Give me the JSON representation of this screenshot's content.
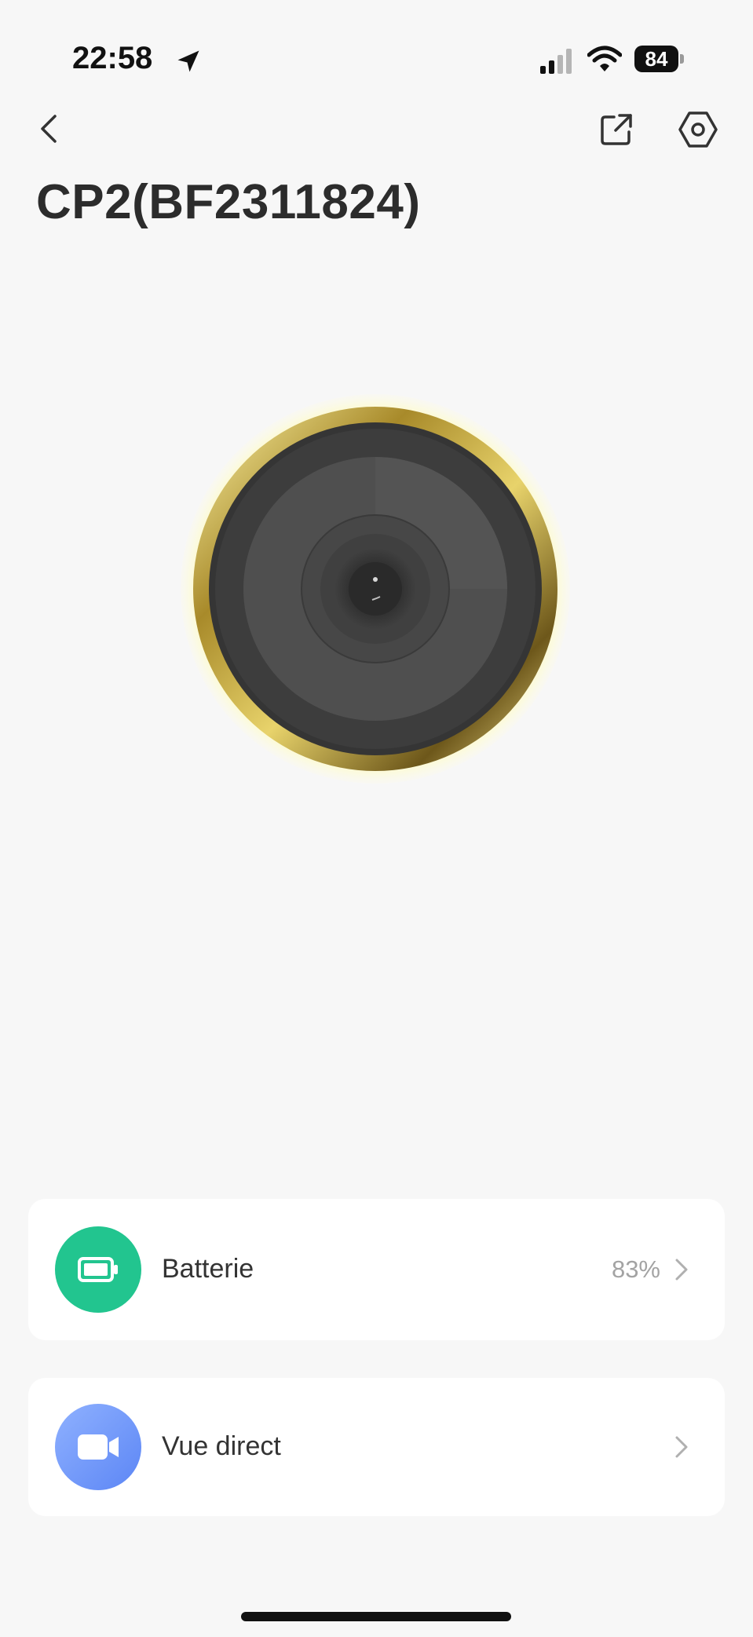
{
  "status_bar": {
    "time": "22:58",
    "battery_level": "84",
    "icons": [
      "location-arrow-icon",
      "cellular-signal-icon",
      "wifi-icon",
      "battery-icon"
    ]
  },
  "header": {
    "back_icon": "chevron-left-icon",
    "share_icon": "share-external-icon",
    "settings_icon": "hexagon-gear-icon",
    "title": "CP2(BF2311824)"
  },
  "device": {
    "image": "door-viewer-camera-lens"
  },
  "rows": [
    {
      "icon": "battery-icon",
      "icon_color": "#22c58f",
      "label": "Batterie",
      "value": "83%"
    },
    {
      "icon": "video-camera-icon",
      "icon_color": "#6b92f7",
      "label": "Vue direct",
      "value": ""
    }
  ]
}
